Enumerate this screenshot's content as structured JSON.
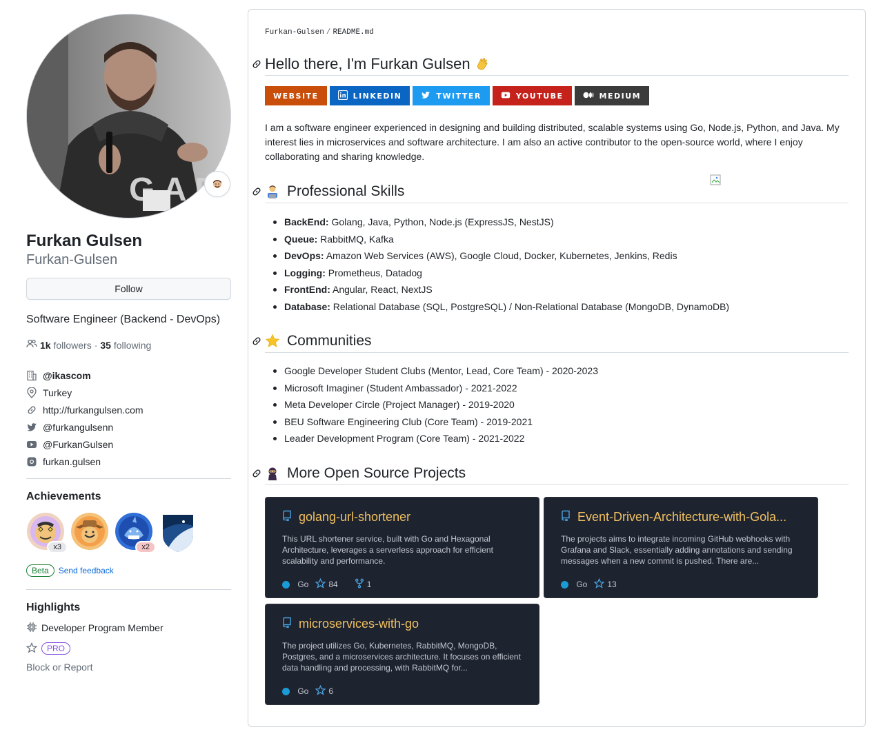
{
  "profile": {
    "fullname": "Furkan Gulsen",
    "username": "Furkan-Gulsen",
    "follow_label": "Follow",
    "bio": "Software Engineer (Backend - DevOps)",
    "followers_count": "1k",
    "followers_label": "followers",
    "following_count": "35",
    "following_label": "following",
    "details": {
      "org": "@ikascom",
      "location": "Turkey",
      "website": "http://furkangulsen.com",
      "twitter": "@furkangulsenn",
      "youtube": "@FurkanGulsen",
      "instagram": "furkan.gulsen"
    },
    "achievements_title": "Achievements",
    "achievements": [
      {
        "icon": "starstruck-badge",
        "count": "x3"
      },
      {
        "icon": "yolo-cowboy-badge",
        "count": ""
      },
      {
        "icon": "shark-badge",
        "count": "x2"
      },
      {
        "icon": "arctic-code-vault-badge",
        "count": ""
      }
    ],
    "beta_label": "Beta",
    "feedback_label": "Send feedback",
    "highlights_title": "Highlights",
    "highlight_developer": "Developer Program Member",
    "pro_label": "PRO",
    "block_label": "Block or Report"
  },
  "readme": {
    "crumb_user": "Furkan-Gulsen",
    "crumb_file": "README.md",
    "heading": "Hello there, I'm Furkan Gulsen",
    "shields": [
      {
        "label": "WEBSITE",
        "color": "#c94e0a",
        "icon": ""
      },
      {
        "label": "LINKEDIN",
        "color": "#0a66c2",
        "icon": "linkedin-icon"
      },
      {
        "label": "TWITTER",
        "color": "#1d9bf0",
        "icon": "twitter-icon"
      },
      {
        "label": "YOUTUBE",
        "color": "#c4221b",
        "icon": "youtube-icon"
      },
      {
        "label": "MEDIUM",
        "color": "#3b3b3b",
        "icon": "medium-icon"
      }
    ],
    "intro": "I am a software engineer experienced in designing and building distributed, scalable systems using Go, Node.js, Python, and Java. My interest lies in microservices and software architecture. I am also an active contributor to the open-source world, where I enjoy collaborating and sharing knowledge.",
    "skills_heading": "Professional Skills",
    "skills": [
      {
        "key": "BackEnd:",
        "value": " Golang, Java, Python, Node.js (ExpressJS, NestJS)"
      },
      {
        "key": "Queue:",
        "value": " RabbitMQ, Kafka"
      },
      {
        "key": "DevOps:",
        "value": " Amazon Web Services (AWS), Google Cloud, Docker, Kubernetes, Jenkins, Redis"
      },
      {
        "key": "Logging:",
        "value": " Prometheus, Datadog"
      },
      {
        "key": "FrontEnd:",
        "value": " Angular, React, NextJS"
      },
      {
        "key": "Database:",
        "value": " Relational Database (SQL, PostgreSQL) / Non-Relational Database (MongoDB, DynamoDB)"
      }
    ],
    "communities_heading": "Communities",
    "communities": [
      "Google Developer Student Clubs (Mentor, Lead, Core Team) - 2020-2023",
      "Microsoft Imaginer (Student Ambassador) - 2021-2022",
      "Meta Developer Circle (Project Manager) - 2019-2020",
      "BEU Software Engineering Club (Core Team) - 2019-2021",
      "Leader Development Program (Core Team) - 2021-2022"
    ],
    "projects_heading": "More Open Source Projects",
    "projects": [
      {
        "name": "golang-url-shortener",
        "desc": "This URL shortener service, built with Go and Hexagonal Architecture, leverages a serverless approach for efficient scalability and performance.",
        "lang": "Go",
        "stars": "84",
        "forks": "1"
      },
      {
        "name": "Event-Driven-Architecture-with-Gola...",
        "desc": "The projects aims to integrate incoming GitHub webhooks with Grafana and Slack, essentially adding annotations and sending messages when a new commit is pushed. There are...",
        "lang": "Go",
        "stars": "13",
        "forks": ""
      },
      {
        "name": "microservices-with-go",
        "desc": "The project utilizes Go, Kubernetes, RabbitMQ, MongoDB, Postgres, and a microservices architecture. It focuses on efficient data handling and processing, with RabbitMQ for...",
        "lang": "Go",
        "stars": "6",
        "forks": ""
      }
    ]
  }
}
